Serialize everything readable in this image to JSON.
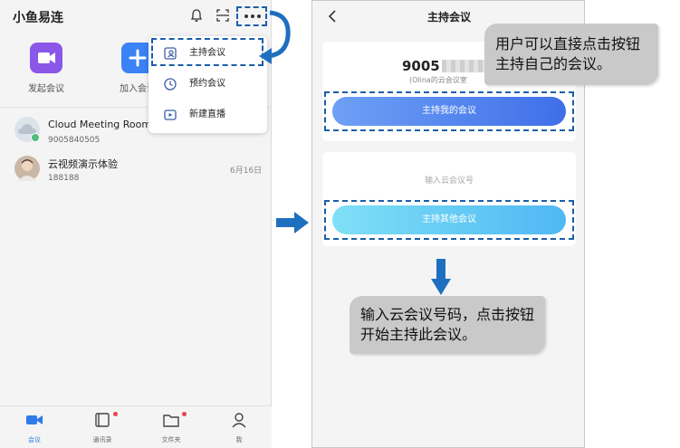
{
  "left_screen": {
    "app_title": "小鱼易连",
    "quick_actions": [
      {
        "label": "发起会议",
        "icon": "video-camera-icon",
        "color": "#8b57e8"
      },
      {
        "label": "加入会议",
        "icon": "plus-icon",
        "color": "#3b82f6"
      }
    ],
    "menu_items": [
      {
        "label": "主持会议",
        "icon": "host-meeting-icon"
      },
      {
        "label": "预约会议",
        "icon": "clock-icon"
      },
      {
        "label": "新建直播",
        "icon": "live-stream-icon"
      }
    ],
    "conversations": [
      {
        "name": "Cloud Meeting Room",
        "sub": "9005840505",
        "date": ""
      },
      {
        "name": "云视频演示体验",
        "sub": "188188",
        "date": "6月16日"
      }
    ],
    "bottom_nav": [
      {
        "label": "会议",
        "active": true
      },
      {
        "label": "通讯录",
        "badge": true
      },
      {
        "label": "文件夹",
        "badge": true
      },
      {
        "label": "我"
      }
    ]
  },
  "right_screen": {
    "title": "主持会议",
    "meeting_number": "9005",
    "meeting_room_label": "(Olina的云会议室",
    "host_my_meeting": "主持我的会议",
    "input_placeholder": "输入云会议号",
    "host_other_meeting": "主持其他会议"
  },
  "callouts": {
    "top": "用户可以直接点击按钮主持自己的会议。",
    "bottom": "输入云会议号码，点击按钮开始主持此会议。"
  },
  "colors": {
    "accent": "#1a5fa8",
    "arrow": "#1f6fbf",
    "button_blue": "#4a7ff0",
    "button_cyan": "#5fd0f5"
  }
}
